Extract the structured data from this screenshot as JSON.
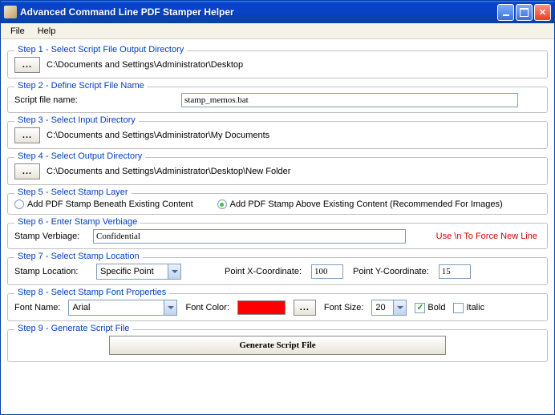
{
  "title": "Advanced Command Line PDF Stamper Helper",
  "menu": {
    "file": "File",
    "help": "Help"
  },
  "step1": {
    "legend": "Step 1 - Select Script File Output Directory",
    "dots": "...",
    "path": "C:\\Documents and Settings\\Administrator\\Desktop"
  },
  "step2": {
    "legend": "Step 2 - Define Script File Name",
    "label": "Script file name:",
    "value": "stamp_memos.bat"
  },
  "step3": {
    "legend": "Step 3 - Select Input Directory",
    "dots": "...",
    "path": "C:\\Documents and Settings\\Administrator\\My Documents"
  },
  "step4": {
    "legend": "Step 4 - Select Output Directory",
    "dots": "...",
    "path": "C:\\Documents and Settings\\Administrator\\Desktop\\New Folder"
  },
  "step5": {
    "legend": "Step 5 - Select Stamp Layer",
    "opt1": "Add PDF Stamp Beneath Existing Content",
    "opt2": "Add PDF Stamp Above Existing Content (Recommended For Images)"
  },
  "step6": {
    "legend": "Step 6 - Enter Stamp Verbiage",
    "label": "Stamp Verbiage:",
    "value": "Confidential",
    "hint": "Use \\n To Force New Line"
  },
  "step7": {
    "legend": "Step 7 - Select Stamp Location",
    "label": "Stamp Location:",
    "dropdown": "Specific Point",
    "xlabel": "Point X-Coordinate:",
    "xval": "100",
    "ylabel": "Point Y-Coordinate:",
    "yval": "15"
  },
  "step8": {
    "legend": "Step 8 - Select Stamp Font Properties",
    "fontname_label": "Font Name:",
    "fontname": "Arial",
    "fontcolor_label": "Font Color:",
    "color": "#ff0000",
    "dots": "...",
    "fontsize_label": "Font Size:",
    "fontsize": "20",
    "bold": "Bold",
    "italic": "Italic"
  },
  "step9": {
    "legend": "Step 9 - Generate Script File",
    "button": "Generate Script File"
  }
}
